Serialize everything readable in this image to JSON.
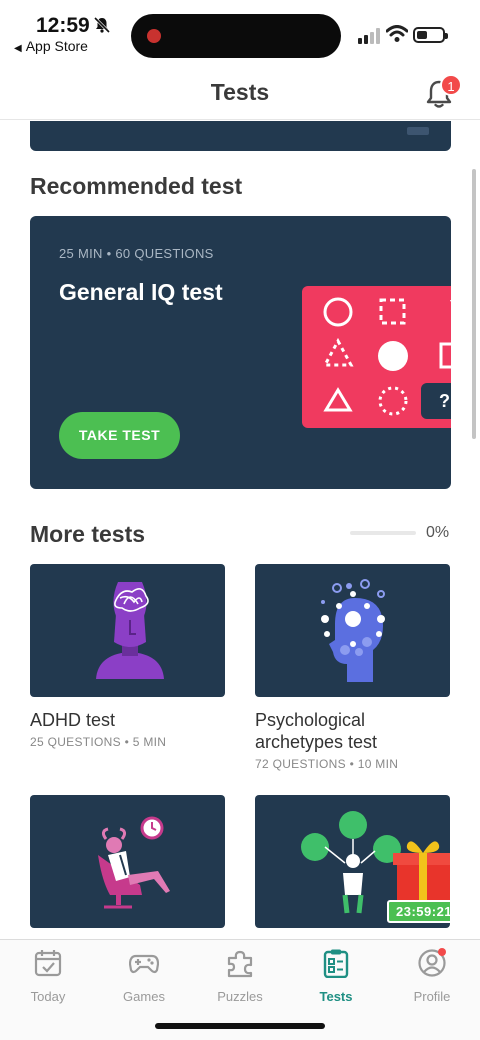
{
  "status": {
    "time": "12:59",
    "back_app": "App Store"
  },
  "header": {
    "title": "Tests",
    "notification_count": "1"
  },
  "recommended": {
    "section_title": "Recommended test",
    "meta": "25 MIN  •  60 QUESTIONS",
    "title": "General IQ test",
    "button": "TAKE TEST",
    "art_tile": "?"
  },
  "more": {
    "section_title": "More tests",
    "progress_label": "0%",
    "progress_fraction": 0,
    "tests": [
      {
        "name": "ADHD test",
        "meta": "25 QUESTIONS  •  5 MIN",
        "art": "brain-scribble-person"
      },
      {
        "name": "Psychological archetypes test",
        "meta": "72 QUESTIONS  •  10 MIN",
        "art": "head-dots"
      },
      {
        "name": "",
        "meta": "",
        "art": "relaxing-chair-clock"
      },
      {
        "name": "",
        "meta": "",
        "art": "gift-people-network",
        "timer": "23:59:21"
      }
    ]
  },
  "tabs": [
    {
      "label": "Today",
      "icon": "calendar-icon",
      "active": false
    },
    {
      "label": "Games",
      "icon": "gamepad-icon",
      "active": false
    },
    {
      "label": "Puzzles",
      "icon": "puzzle-icon",
      "active": false
    },
    {
      "label": "Tests",
      "icon": "clipboard-icon",
      "active": true
    },
    {
      "label": "Profile",
      "icon": "profile-icon",
      "active": false
    }
  ],
  "colors": {
    "card_bg": "#22394f",
    "accent_green": "#4cbf52",
    "iq_art_pink": "#f03a5f",
    "active_tab": "#1f8f83",
    "badge_red": "#f24a4a"
  }
}
